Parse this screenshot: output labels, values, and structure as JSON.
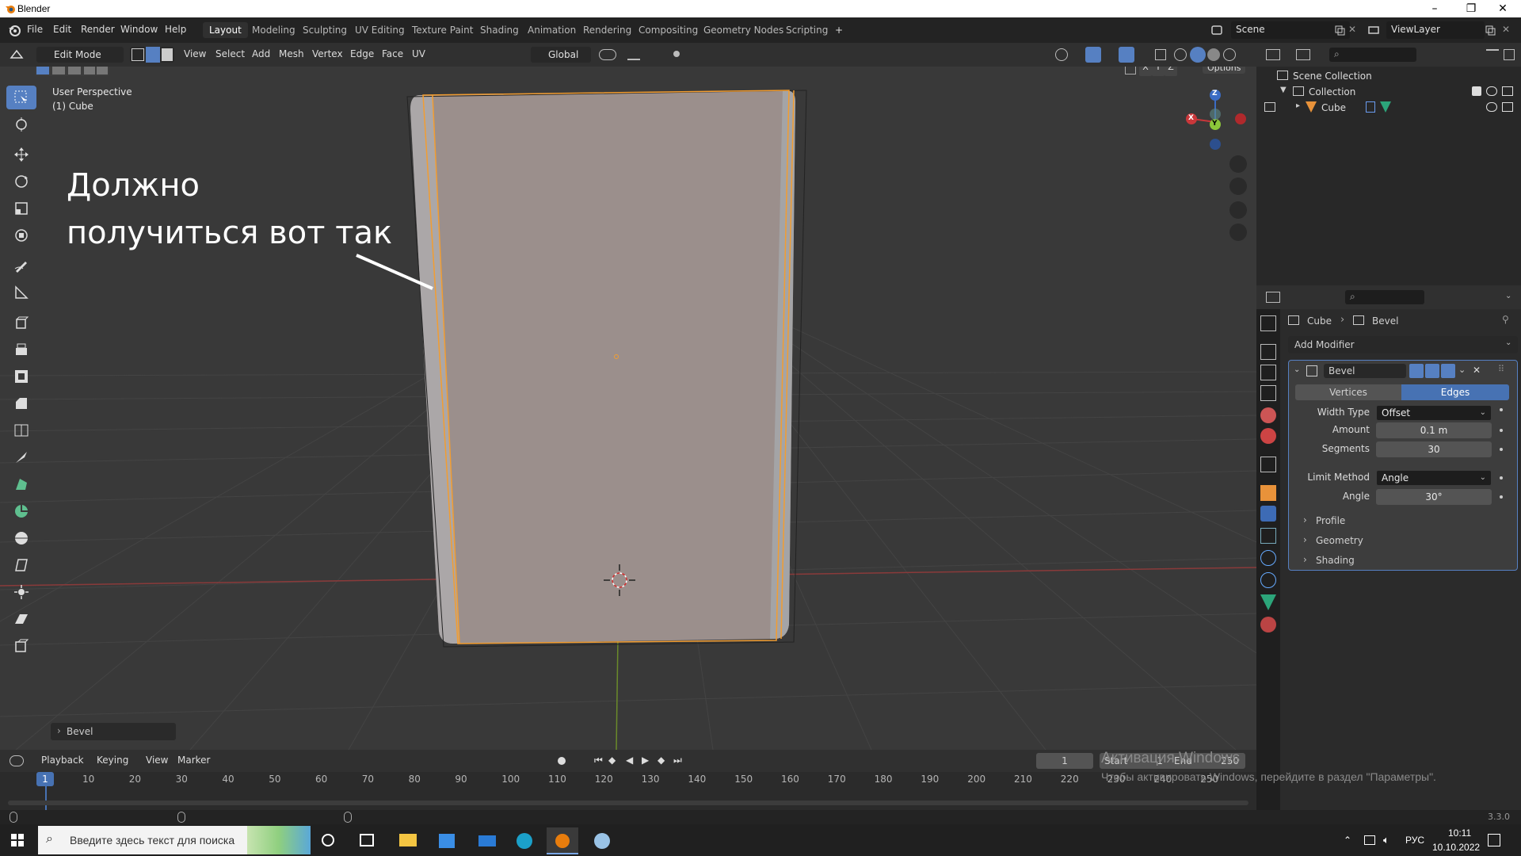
{
  "window": {
    "title": "Blender",
    "minimize": "–",
    "maximize": "❐",
    "close": "✕"
  },
  "menubar": {
    "menus": [
      "File",
      "Edit",
      "Render",
      "Window",
      "Help"
    ],
    "workspaces": [
      "Layout",
      "Modeling",
      "Sculpting",
      "UV Editing",
      "Texture Paint",
      "Shading",
      "Animation",
      "Rendering",
      "Compositing",
      "Geometry Nodes",
      "Scripting"
    ],
    "add_workspace": "+",
    "scene": "Scene",
    "view_layer": "ViewLayer"
  },
  "viewport_header": {
    "mode": "Edit Mode",
    "menus": [
      "View",
      "Select",
      "Add",
      "Mesh",
      "Vertex",
      "Edge",
      "Face",
      "UV"
    ],
    "orientation": "Global",
    "axes": [
      "X",
      "Y",
      "Z"
    ],
    "options": "Options"
  },
  "viewport": {
    "perspective": "User Perspective",
    "object": "(1) Cube",
    "annotation_line1": "Должно",
    "annotation_line2": "получиться вот так",
    "last_op": "Bevel",
    "gizmo": {
      "z": "Z",
      "y": "Y",
      "x": "X"
    }
  },
  "outliner": {
    "scene_collection": "Scene Collection",
    "collection": "Collection",
    "cube": "Cube"
  },
  "properties": {
    "breadcrumb_object": "Cube",
    "breadcrumb_modifier": "Bevel",
    "add_modifier": "Add Modifier",
    "modifier_name": "Bevel",
    "tab_vertices": "Vertices",
    "tab_edges": "Edges",
    "width_type_label": "Width Type",
    "width_type_value": "Offset",
    "amount_label": "Amount",
    "amount_value": "0.1 m",
    "segments_label": "Segments",
    "segments_value": "30",
    "limit_method_label": "Limit Method",
    "limit_method_value": "Angle",
    "angle_label": "Angle",
    "angle_value": "30°",
    "panels": [
      "Profile",
      "Geometry",
      "Shading"
    ]
  },
  "timeline": {
    "menus": [
      "Playback",
      "Keying",
      "View",
      "Marker"
    ],
    "current_frame": "1",
    "start_label": "Start",
    "start_value": "1",
    "end_label": "End",
    "end_value": "250",
    "ticks": [
      "10",
      "20",
      "30",
      "40",
      "50",
      "60",
      "70",
      "80",
      "90",
      "100",
      "110",
      "120",
      "130",
      "140",
      "150",
      "160",
      "170",
      "180",
      "190",
      "200",
      "210",
      "220",
      "230",
      "240",
      "250"
    ],
    "cursor_frame": "1"
  },
  "statusbar": {
    "version": "3.3.0"
  },
  "activation": {
    "line1": "Активация Windows",
    "line2": "Чтобы активировать Windows, перейдите в раздел \"Параметры\"."
  },
  "taskbar": {
    "search_placeholder": "Введите здесь текст для поиска",
    "lang": "РУС",
    "time": "10:11",
    "date": "10.10.2022"
  },
  "colors": {
    "accent": "#5680c2",
    "selection": "#f29d31",
    "mesh_face": "#9b8f8c"
  }
}
